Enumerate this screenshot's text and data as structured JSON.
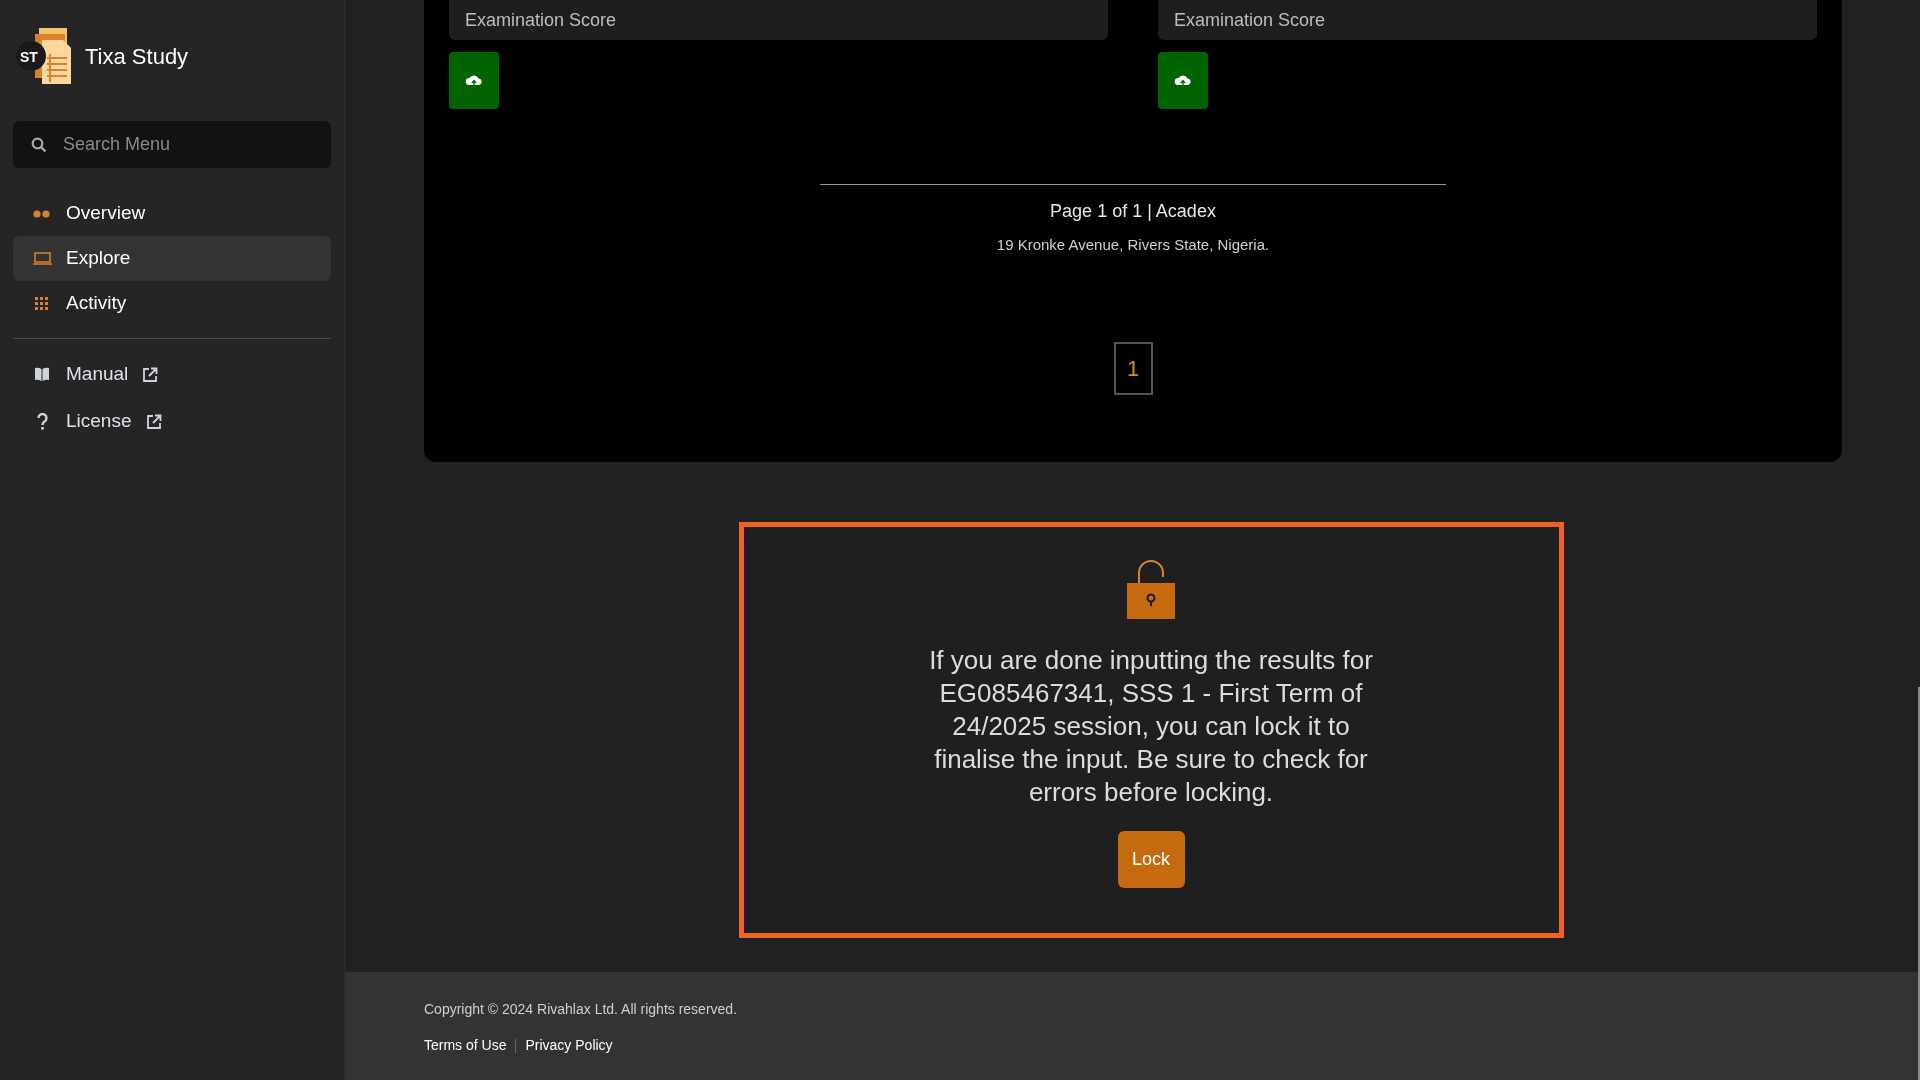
{
  "brand": {
    "logo_text": "ST",
    "name": "Tixa Study"
  },
  "search": {
    "placeholder": "Search Menu"
  },
  "nav": [
    {
      "label": "Overview",
      "selected": false
    },
    {
      "label": "Explore",
      "selected": true
    },
    {
      "label": "Activity",
      "selected": false
    }
  ],
  "links": [
    {
      "label": "Manual",
      "external": true
    },
    {
      "label": "License",
      "external": true
    }
  ],
  "score_fields": [
    {
      "label": "Examination Score"
    },
    {
      "label": "Examination Score"
    }
  ],
  "report_footer": {
    "page": "Page 1 of 1 | Acadex",
    "address": "19 Kronke Avenue, Rivers State, Nigeria."
  },
  "pagination": [
    {
      "label": "1",
      "selected": true
    }
  ],
  "lock_panel": {
    "locked": false,
    "message": "If you are done inputting the results for EG085467341, SSS 1 - First Term of 24/2025 session, you can lock it to finalise the input. Be sure to check for errors before locking.",
    "button": "Lock"
  },
  "footer": {
    "copyright": "Copyright © 2024 Rivahlax Ltd. All rights reserved.",
    "links": [
      "Terms of Use",
      "Privacy Policy"
    ]
  }
}
